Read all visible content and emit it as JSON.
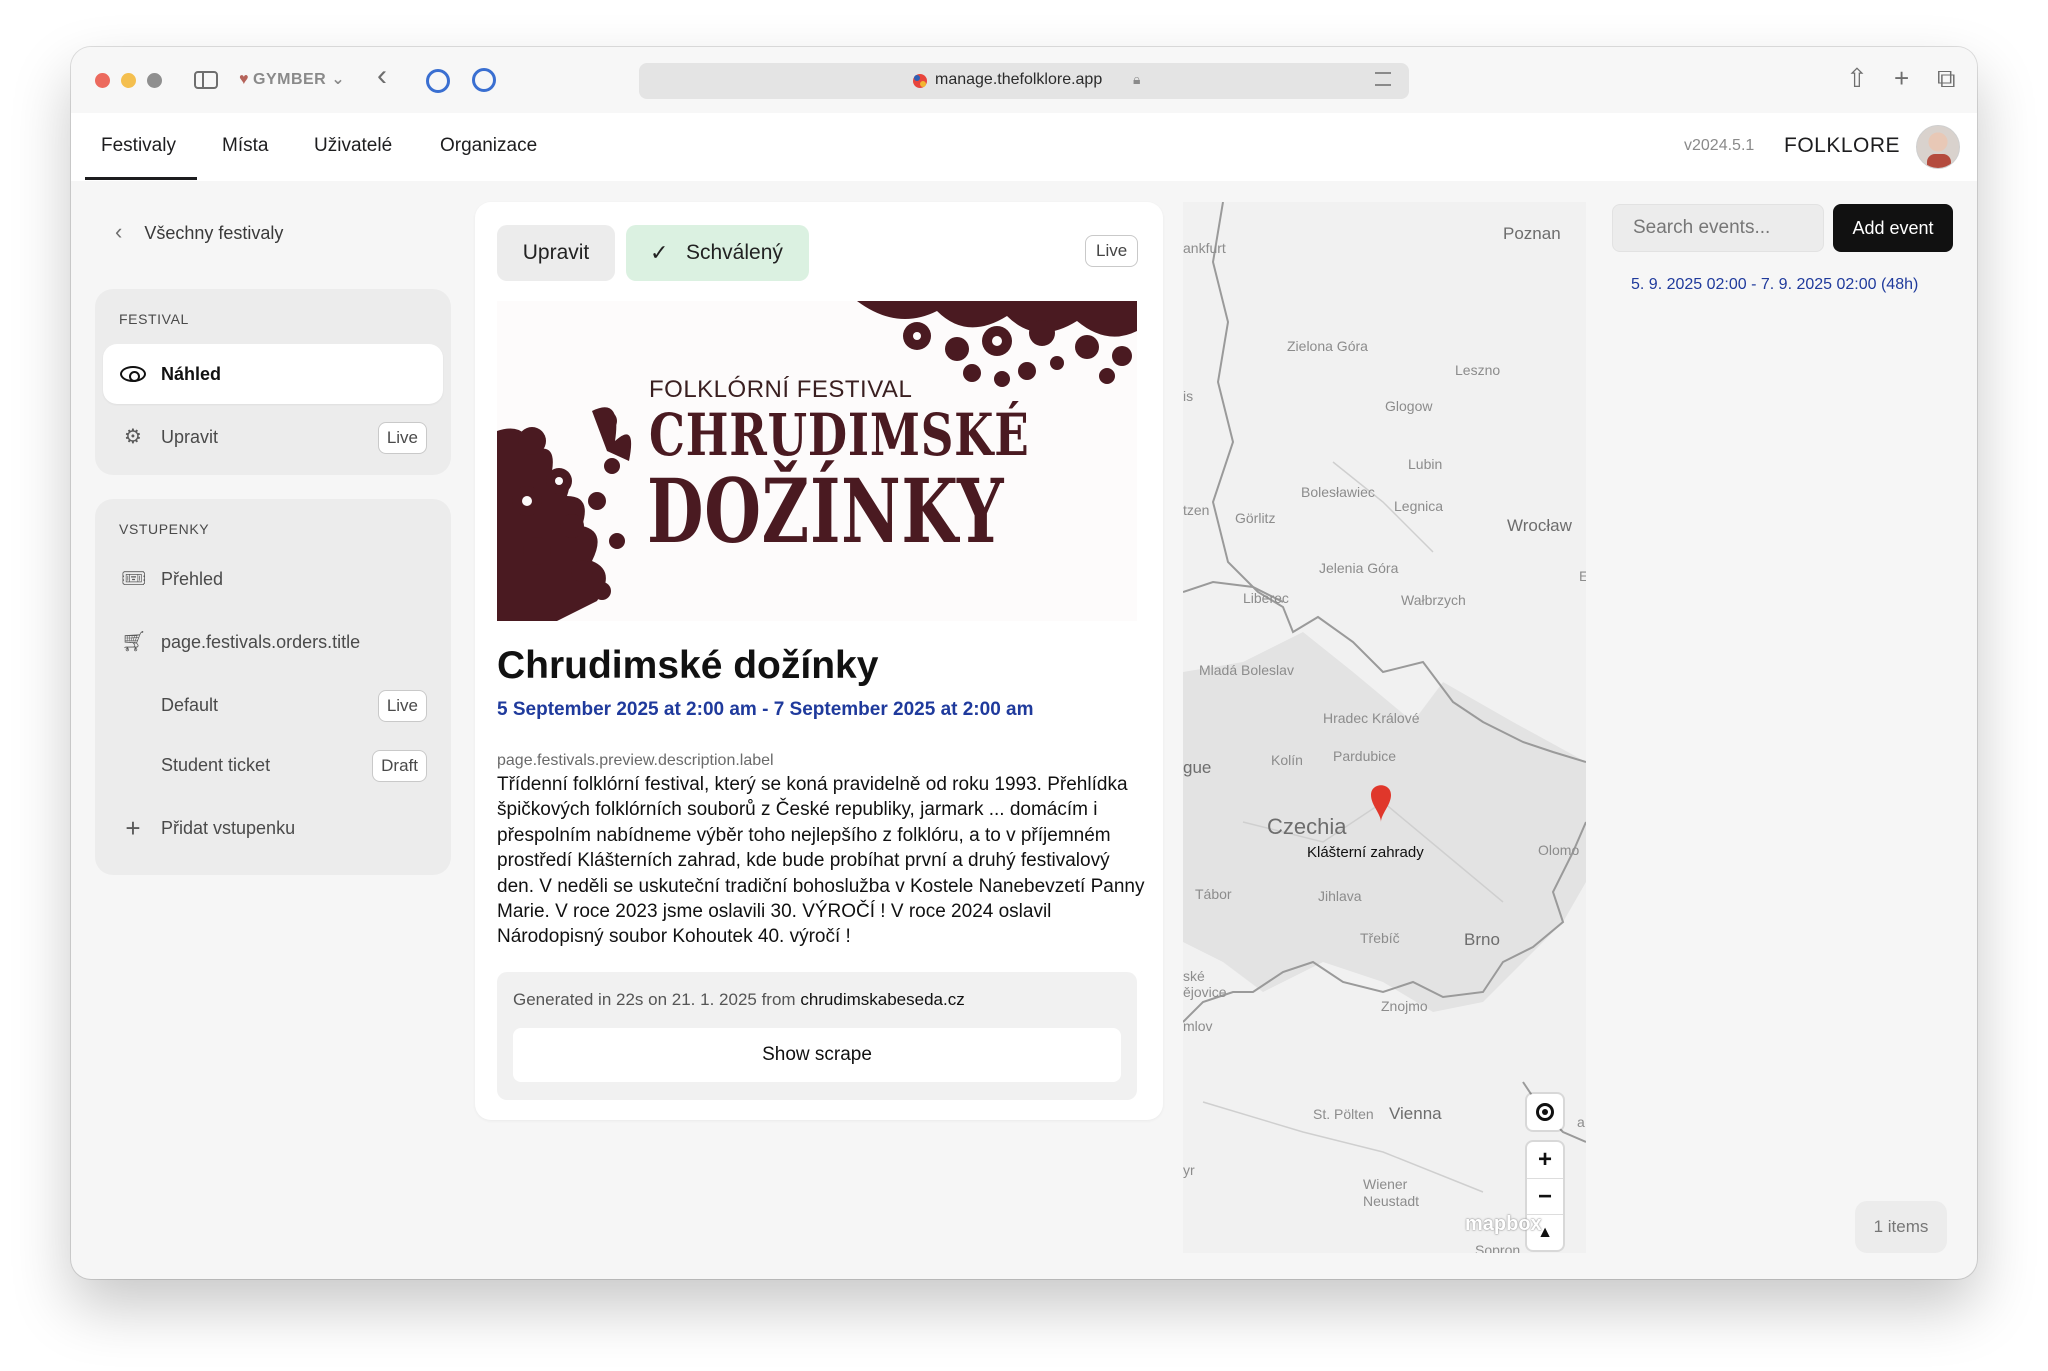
{
  "browser": {
    "profile_name": "GYMBER",
    "url": "manage.thefolklore.app"
  },
  "header": {
    "tabs": [
      "Festivaly",
      "Místa",
      "Uživatelé",
      "Organizace"
    ],
    "version": "v2024.5.1",
    "brand": "FOLKLORE"
  },
  "sidebar": {
    "back_label": "Všechny festivaly",
    "festival_group": {
      "title": "FESTIVAL",
      "items": [
        {
          "label": "Náhled",
          "icon": "eye-icon",
          "active": true
        },
        {
          "label": "Upravit",
          "icon": "gear-icon",
          "badge": "Live"
        }
      ]
    },
    "tickets_group": {
      "title": "VSTUPENKY",
      "items": [
        {
          "label": "Přehled",
          "icon": "ticket-icon"
        },
        {
          "label": "page.festivals.orders.title",
          "icon": "cart-icon"
        },
        {
          "label": "Default",
          "badge": "Live"
        },
        {
          "label": "Student ticket",
          "badge": "Draft"
        },
        {
          "label": "Přidat vstupenku",
          "icon": "plus-icon"
        }
      ]
    }
  },
  "card": {
    "edit_label": "Upravit",
    "status_label": "Schválený",
    "live_badge": "Live",
    "banner": {
      "kicker": "FOLKLÓRNÍ FESTIVAL",
      "line1": "CHRUDIMSKÉ",
      "line2": "DOŽÍNKY",
      "accent_color": "#4a1a21"
    },
    "title": "Chrudimské dožínky",
    "dates": "5 September 2025 at 2:00 am - 7 September 2025 at 2:00 am",
    "description_label": "page.festivals.preview.description.label",
    "description": "Třídenní folklórní festival, který se koná pravidelně od roku 1993. Přehlídka špičkových folklórních souborů z České republiky, jarmark ... domácím i přespolním nabídneme výběr toho nejlepšího z folklóru, a to v příjemném prostředí Klášterních zahrad, kde bude probíhat první a druhý festivalový den. V neděli se uskuteční tradiční bohoslužba v Kostele Nanebevzetí Panny Marie. V roce 2023 jsme oslavili 30. VÝROČÍ ! V roce 2024 oslavil Národopisný soubor Kohoutek 40. výročí !",
    "generated_prefix": "Generated in 22s on 21. 1. 2025 from ",
    "generated_source": "chrudimskabeseda.cz",
    "show_scrape_label": "Show scrape"
  },
  "map": {
    "cities": [
      "ankfurt",
      "Poznan",
      "Zielona Góra",
      "Leszno",
      "Glogow",
      "Lubin",
      "Bolesławiec",
      "Legnica",
      "Wrocław",
      "Görlitz",
      "Jelenia Góra",
      "Liberec",
      "Wałbrzych",
      "Mladá Boleslav",
      "Hradec Králové",
      "Kolín",
      "Pardubice",
      "Olomo",
      "Tábor",
      "Jihlava",
      "Třebíč",
      "Brno",
      "Znojmo",
      "St. Pölten",
      "Vienna",
      "Wiener Neustadt",
      "Sopron",
      "gue",
      "is",
      "tzen",
      "ské",
      "ějovice",
      "mlov",
      "yr",
      "a",
      "E"
    ],
    "country_label": "Czechia",
    "marker_label": "Klášterní zahrady",
    "marker_color": "#e0372b",
    "attribution": "mapbox"
  },
  "events_panel": {
    "search_placeholder": "Search events...",
    "add_event_label": "Add event",
    "event_range": "5. 9. 2025 02:00 - 7. 9. 2025 02:00 (48h)",
    "items_count": "1 items"
  }
}
